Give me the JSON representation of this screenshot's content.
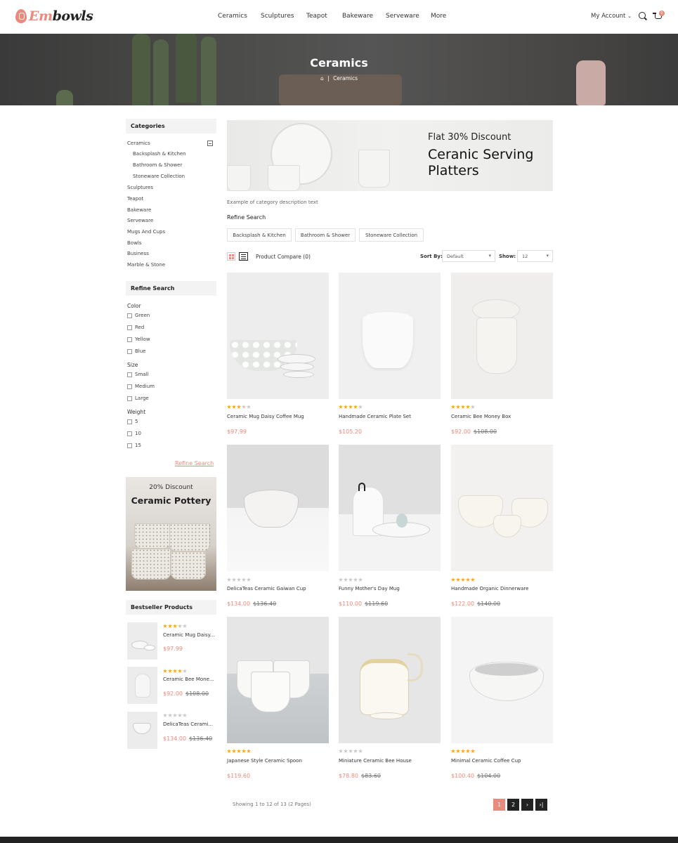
{
  "brand": {
    "logo_prefix": "Em",
    "logo_suffix": "bowls",
    "accent": "#e98a7c"
  },
  "nav": {
    "items": [
      "Ceramics",
      "Sculptures",
      "Teapot",
      "Bakeware",
      "Serveware",
      "More"
    ],
    "account": "My Account",
    "cart_count": "0"
  },
  "banner": {
    "title": "Ceramics",
    "breadcrumb_sep": "|",
    "breadcrumb_current": "Ceramics"
  },
  "sidebar": {
    "categories_title": "Categories",
    "categories": [
      "Ceramics",
      "Backsplash & Kitchen",
      "Bathroom & Shower",
      "Stoneware Collection",
      "Sculptures",
      "Teapot",
      "Bakeware",
      "Serveware",
      "Mugs And Cups",
      "Bowls",
      "Business",
      "Marble & Stone"
    ],
    "refine_title": "Refine Search",
    "filters": {
      "color_label": "Color",
      "colors": [
        "Green",
        "Red",
        "Yellow",
        "Blue"
      ],
      "size_label": "Size",
      "sizes": [
        "Small",
        "Medium",
        "Large"
      ],
      "weight_label": "Weight",
      "weights": [
        "5",
        "10",
        "15"
      ]
    },
    "refine_link": "Refine Search",
    "promo": {
      "line1": "20% Discount",
      "line2": "Ceramic Pottery"
    },
    "bestseller_title": "Bestseller Products",
    "bestsellers": [
      {
        "name": "Ceramic Mug Daisy...",
        "price": "$97.99",
        "old": "",
        "rating": 3
      },
      {
        "name": "Ceramic Bee Mone...",
        "price": "$92.00",
        "old": "$108.00",
        "rating": 4
      },
      {
        "name": "DelicaTeas Cerami...",
        "price": "$134.00",
        "old": "$136.40",
        "rating": 0
      }
    ]
  },
  "hero": {
    "line1": "Flat 30% Discount",
    "line2": "Ceranic Serving",
    "line3": "Platters"
  },
  "main": {
    "description": "Example of category description text",
    "refine_title": "Refine Search",
    "chips": [
      "Backsplash & Kitchen",
      "Bathroom & Shower",
      "Stoneware Collection"
    ],
    "compare": "Product Compare (0)",
    "sort_label": "Sort By:",
    "sort_value": "Default",
    "show_label": "Show:",
    "show_value": "12"
  },
  "products": [
    {
      "name": "Ceramic Mug Daisy Coffee Mug",
      "price": "$97.99",
      "old": "",
      "rating": 3
    },
    {
      "name": "Handmade Ceramic Plate Set",
      "price": "$105.20",
      "old": "",
      "rating": 4
    },
    {
      "name": "Ceramic Bee Money Box",
      "price": "$92.00",
      "old": "$108.00",
      "rating": 4
    },
    {
      "name": "DelicaTeas Ceramic Gaiwan Cup",
      "price": "$134.00",
      "old": "$136.40",
      "rating": 0
    },
    {
      "name": "Funny Mother's Day Mug",
      "price": "$110.00",
      "old": "$119.60",
      "rating": 0
    },
    {
      "name": "Handmade Organic Dinnerware",
      "price": "$122.00",
      "old": "$140.00",
      "rating": 5
    },
    {
      "name": "Japanese Style Ceramic Spoon",
      "price": "$119.60",
      "old": "",
      "rating": 5
    },
    {
      "name": "Miniature Ceramic Bee House",
      "price": "$78.80",
      "old": "$83.60",
      "rating": 0
    },
    {
      "name": "Minimal Ceramic Coffee Cup",
      "price": "$100.40",
      "old": "$104.00",
      "rating": 5
    }
  ],
  "pagination": {
    "showing": "Showing 1 to 12 of 13 (2 Pages)",
    "pages": [
      "1",
      "2",
      "›",
      "›|"
    ]
  }
}
